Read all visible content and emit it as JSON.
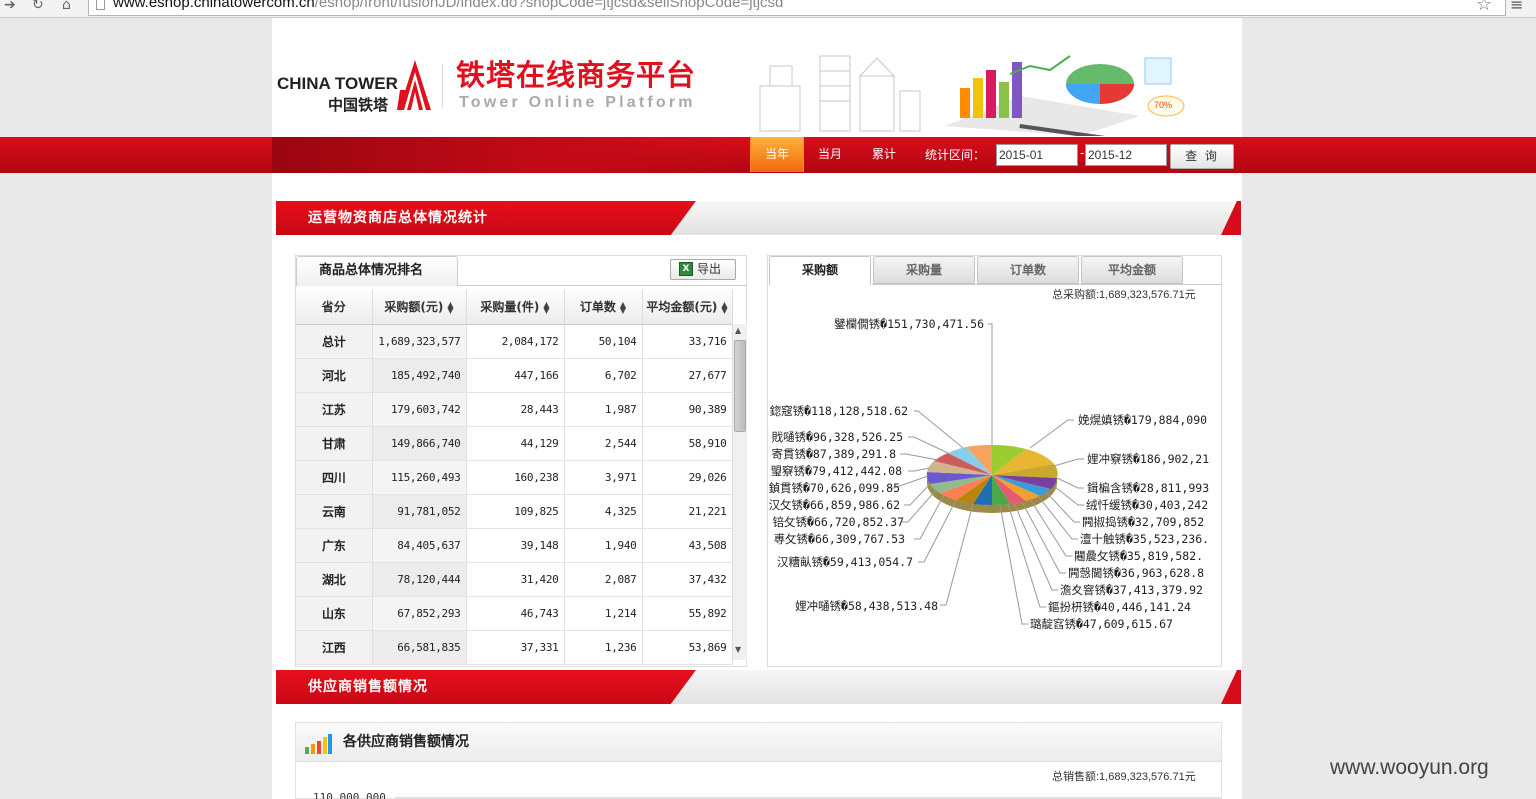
{
  "browser": {
    "url_host": "www.eshop.chinatowercom.cn",
    "url_path": "/eshop/front/fusionJD/index.do?shopCode=jtjcsd&sellShopCode=jtjcsd"
  },
  "header": {
    "logo_en": "CHINA TOWER",
    "logo_cn": "中国铁塔",
    "platform_cn": "铁塔在线商务平台",
    "platform_en": "Tower Online Platform"
  },
  "nav": {
    "current_year": "当年",
    "current_month": "当月",
    "cumulative": "累计",
    "range_label": "统计区间：",
    "date_start": "2015-01",
    "date_end": "2015-12",
    "query_button": "查 询"
  },
  "section1": {
    "title": "运营物资商店总体情况统计"
  },
  "ranking": {
    "tab_label": "商品总体情况排名",
    "export_label": "导出",
    "columns": [
      "省分",
      "采购额(元)",
      "采购量(件)",
      "订单数",
      "平均金额(元)"
    ],
    "rows": [
      [
        "总计",
        "1,689,323,577",
        "2,084,172",
        "50,104",
        "33,716"
      ],
      [
        "河北",
        "185,492,740",
        "447,166",
        "6,702",
        "27,677"
      ],
      [
        "江苏",
        "179,603,742",
        "28,443",
        "1,987",
        "90,389"
      ],
      [
        "甘肃",
        "149,866,740",
        "44,129",
        "2,544",
        "58,910"
      ],
      [
        "四川",
        "115,260,493",
        "160,238",
        "3,971",
        "29,026"
      ],
      [
        "云南",
        "91,781,052",
        "109,825",
        "4,325",
        "21,221"
      ],
      [
        "广东",
        "84,405,637",
        "39,148",
        "1,940",
        "43,508"
      ],
      [
        "湖北",
        "78,120,444",
        "31,420",
        "2,087",
        "37,432"
      ],
      [
        "山东",
        "67,852,293",
        "46,743",
        "1,214",
        "55,892"
      ],
      [
        "江西",
        "66,581,835",
        "37,331",
        "1,236",
        "53,869"
      ]
    ]
  },
  "pie_panel": {
    "tabs": [
      "采购额",
      "采购量",
      "订单数",
      "平均金额"
    ],
    "total_label": "总采购额:1,689,323,576.71元",
    "labels": {
      "top": "鐾欄僩锈�151,730,471.56",
      "l1": "鍃窛锈�118,128,518.62",
      "l2": "戝嗵锈�96,328,526.25",
      "l3": "寄貫锈�87,389,291.8",
      "l4": "琞竂锈�79,412,442.08",
      "l5": "鍞貫锈�70,626,099.85",
      "l6": "汉攵锈�66,859,986.62",
      "l7": "锫攵锈�66,720,852.37",
      "l8": "尃攵锈�66,309,767.53",
      "l9": "汉糟畒锈�59,413,054.7",
      "l10": "娌冲嗵锈�58,438,513.48",
      "r1": "娩熀嫃锈�179,884,090",
      "r2": "娌冲竂锈�186,902,21",
      "r3": "鍓楄含锈�28,811,993",
      "r4": "绒忏缓锈�30,403,242",
      "r5": "闁掓捣锈�32,709,852",
      "r6": "澶十触锈�35,523,236.",
      "r7": "闀曟攵锈�35,819,582.",
      "r8": "闁愨閫锈�36,963,628.8",
      "r9": "澹夊窨锈�37,413,379.92",
      "r10": "鏂扮枅锈�40,446,141.24",
      "r11": "璐靛窞锈�47,609,615.67"
    }
  },
  "section2": {
    "title": "供应商销售额情况"
  },
  "supplier": {
    "title": "各供应商销售额情况",
    "total_label": "总销售额:1,689,323,576.71元",
    "y_top": "110,000,000"
  },
  "watermark": "www.wooyun.org"
}
